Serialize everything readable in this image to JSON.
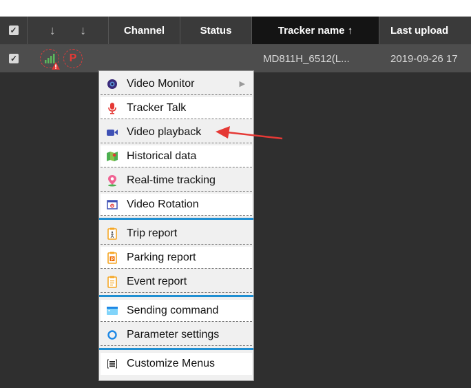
{
  "header": {
    "columns": [
      {
        "label": "Channel"
      },
      {
        "label": "Status"
      },
      {
        "label": "Tracker name ↑"
      },
      {
        "label": "Last upload"
      }
    ]
  },
  "row": {
    "tracker_name": "MD811H_6512(L...",
    "last_upload": "2019-09-26 17",
    "status_icons": [
      "signal-warning-icon",
      "parking-icon"
    ]
  },
  "menu": {
    "items": [
      {
        "label": "Video Monitor",
        "icon": "video-monitor-icon",
        "has_submenu": true
      },
      {
        "label": "Tracker Talk",
        "icon": "microphone-icon"
      },
      {
        "label": "Video playback",
        "icon": "video-camera-icon"
      },
      {
        "label": "Historical data",
        "icon": "map-icon"
      },
      {
        "label": "Real-time tracking",
        "icon": "location-icon"
      },
      {
        "label": "Video Rotation",
        "icon": "video-rotation-icon"
      },
      {
        "label": "Trip report",
        "icon": "trip-report-icon"
      },
      {
        "label": "Parking report",
        "icon": "parking-report-icon"
      },
      {
        "label": "Event report",
        "icon": "event-report-icon"
      },
      {
        "label": "Sending command",
        "icon": "command-window-icon"
      },
      {
        "label": "Parameter settings",
        "icon": "circle-settings-icon"
      },
      {
        "label": "Customize Menus",
        "icon": "list-menu-icon"
      }
    ]
  },
  "colors": {
    "accent": "#1f8fd2",
    "arrow_annotation": "#e53935",
    "header_bg": "#3a3a3a",
    "row_bg": "#4d4d4d"
  }
}
